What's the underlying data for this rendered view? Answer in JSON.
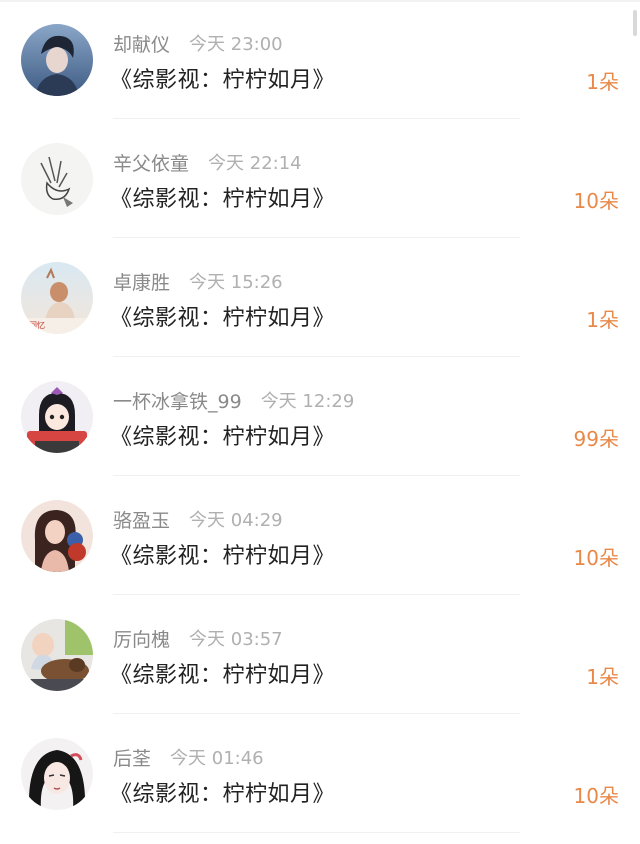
{
  "items": [
    {
      "name": "却献仪",
      "time": "今天 23:00",
      "title": "《综影视：柠柠如月》",
      "amount": "1朵"
    },
    {
      "name": "辛父依童",
      "time": "今天 22:14",
      "title": "《综影视：柠柠如月》",
      "amount": "10朵"
    },
    {
      "name": "卓康胜",
      "time": "今天 15:26",
      "title": "《综影视：柠柠如月》",
      "amount": "1朵"
    },
    {
      "name": "一杯冰拿铁_99",
      "time": "今天 12:29",
      "title": "《综影视：柠柠如月》",
      "amount": "99朵"
    },
    {
      "name": "骆盈玉",
      "time": "今天 04:29",
      "title": "《综影视：柠柠如月》",
      "amount": "10朵"
    },
    {
      "name": "厉向槐",
      "time": "今天 03:57",
      "title": "《综影视：柠柠如月》",
      "amount": "1朵"
    },
    {
      "name": "后荃",
      "time": "今天 01:46",
      "title": "《综影视：柠柠如月》",
      "amount": "10朵"
    }
  ],
  "colors": {
    "amount": "#e8894a",
    "name": "#8a8a8a",
    "time": "#b0b0b0",
    "title": "#222222"
  }
}
